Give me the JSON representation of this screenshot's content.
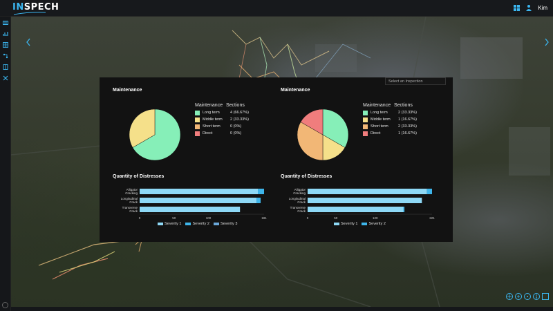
{
  "app": {
    "logo_text": "INSPECH",
    "user_name": "Kim"
  },
  "colors": {
    "accent": "#3bb6f0",
    "long_term": "#86efb8",
    "middle_term": "#f5e08a",
    "short_term": "#f2b776",
    "direct": "#f07d7d",
    "severity1": "#8ed8f5",
    "severity2": "#3eb5ea",
    "severity3": "#6aa7d8"
  },
  "sidebar": {
    "items": [
      {
        "icon": "map-icon"
      },
      {
        "icon": "bar-chart-icon"
      },
      {
        "icon": "table-icon"
      },
      {
        "icon": "network-icon"
      },
      {
        "icon": "book-icon"
      },
      {
        "icon": "tools-icon"
      }
    ]
  },
  "panel": {
    "select_placeholder": "Select an Inspection",
    "left": {
      "maintenance_title": "Maintenance",
      "legend_header_1": "Maintenance",
      "legend_header_2": "Sections",
      "legend": [
        {
          "label": "Long term",
          "value": "4 (66.67%)"
        },
        {
          "label": "Middle term",
          "value": "2 (33.33%)"
        },
        {
          "label": "Short term",
          "value": "0 (0%)"
        },
        {
          "label": "Direct",
          "value": "0 (0%)"
        }
      ],
      "distress_title": "Quantity of Distresses"
    },
    "right": {
      "maintenance_title": "Maintenance",
      "legend_header_1": "Maintenance",
      "legend_header_2": "Sections",
      "legend": [
        {
          "label": "Long term",
          "value": "2 (33.33%)"
        },
        {
          "label": "Middle term",
          "value": "1 (16.67%)"
        },
        {
          "label": "Short term",
          "value": "2 (33.33%)"
        },
        {
          "label": "Direct",
          "value": "1 (16.67%)"
        }
      ],
      "distress_title": "Quantity of Distresses"
    }
  },
  "chart_data": [
    {
      "type": "pie",
      "labels": [
        "Long term",
        "Middle term",
        "Short term",
        "Direct"
      ],
      "values": [
        4,
        2,
        0,
        0
      ],
      "title": "Maintenance"
    },
    {
      "type": "bar",
      "orientation": "horizontal",
      "stacked": true,
      "title": "Quantity of Distresses",
      "categories": [
        "Alligator Cracking",
        "Longitudinal Crack",
        "Transverse Crack"
      ],
      "series": [
        {
          "name": "Severity 1",
          "values": [
            172,
            170,
            146
          ]
        },
        {
          "name": "Severity 2",
          "values": [
            9,
            6,
            0
          ]
        },
        {
          "name": "Severity 3",
          "values": [
            0,
            0,
            0
          ]
        }
      ],
      "x_ticks": [
        "0",
        "50",
        "100",
        "181"
      ],
      "xlim": [
        0,
        181
      ]
    },
    {
      "type": "pie",
      "labels": [
        "Long term",
        "Middle term",
        "Short term",
        "Direct"
      ],
      "values": [
        2,
        1,
        2,
        1
      ],
      "title": "Maintenance"
    },
    {
      "type": "bar",
      "orientation": "horizontal",
      "stacked": true,
      "title": "Quantity of Distresses",
      "categories": [
        "Alligator Cracking",
        "Longitudinal Crack",
        "Transverse Crack"
      ],
      "series": [
        {
          "name": "Severity 1",
          "values": [
            212,
            203,
            170
          ]
        },
        {
          "name": "Severity 2",
          "values": [
            9,
            0,
            2
          ]
        }
      ],
      "x_ticks": [
        "0",
        "50",
        "120",
        "221"
      ],
      "xlim": [
        0,
        221
      ]
    }
  ]
}
